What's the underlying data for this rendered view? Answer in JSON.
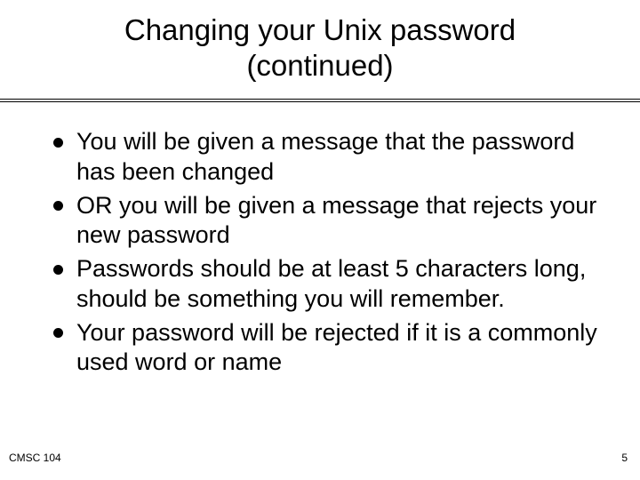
{
  "slide": {
    "title_line1": "Changing your Unix password",
    "title_line2": "(continued)",
    "bullets": [
      "You will be given a message that the password has been changed",
      "OR you will be given a message that rejects your new password",
      "Passwords should be at least 5 characters long, should be something you will remember.",
      "Your password will be rejected if it is a commonly used word or name"
    ],
    "footer_left": "CMSC 104",
    "page_number": "5"
  }
}
